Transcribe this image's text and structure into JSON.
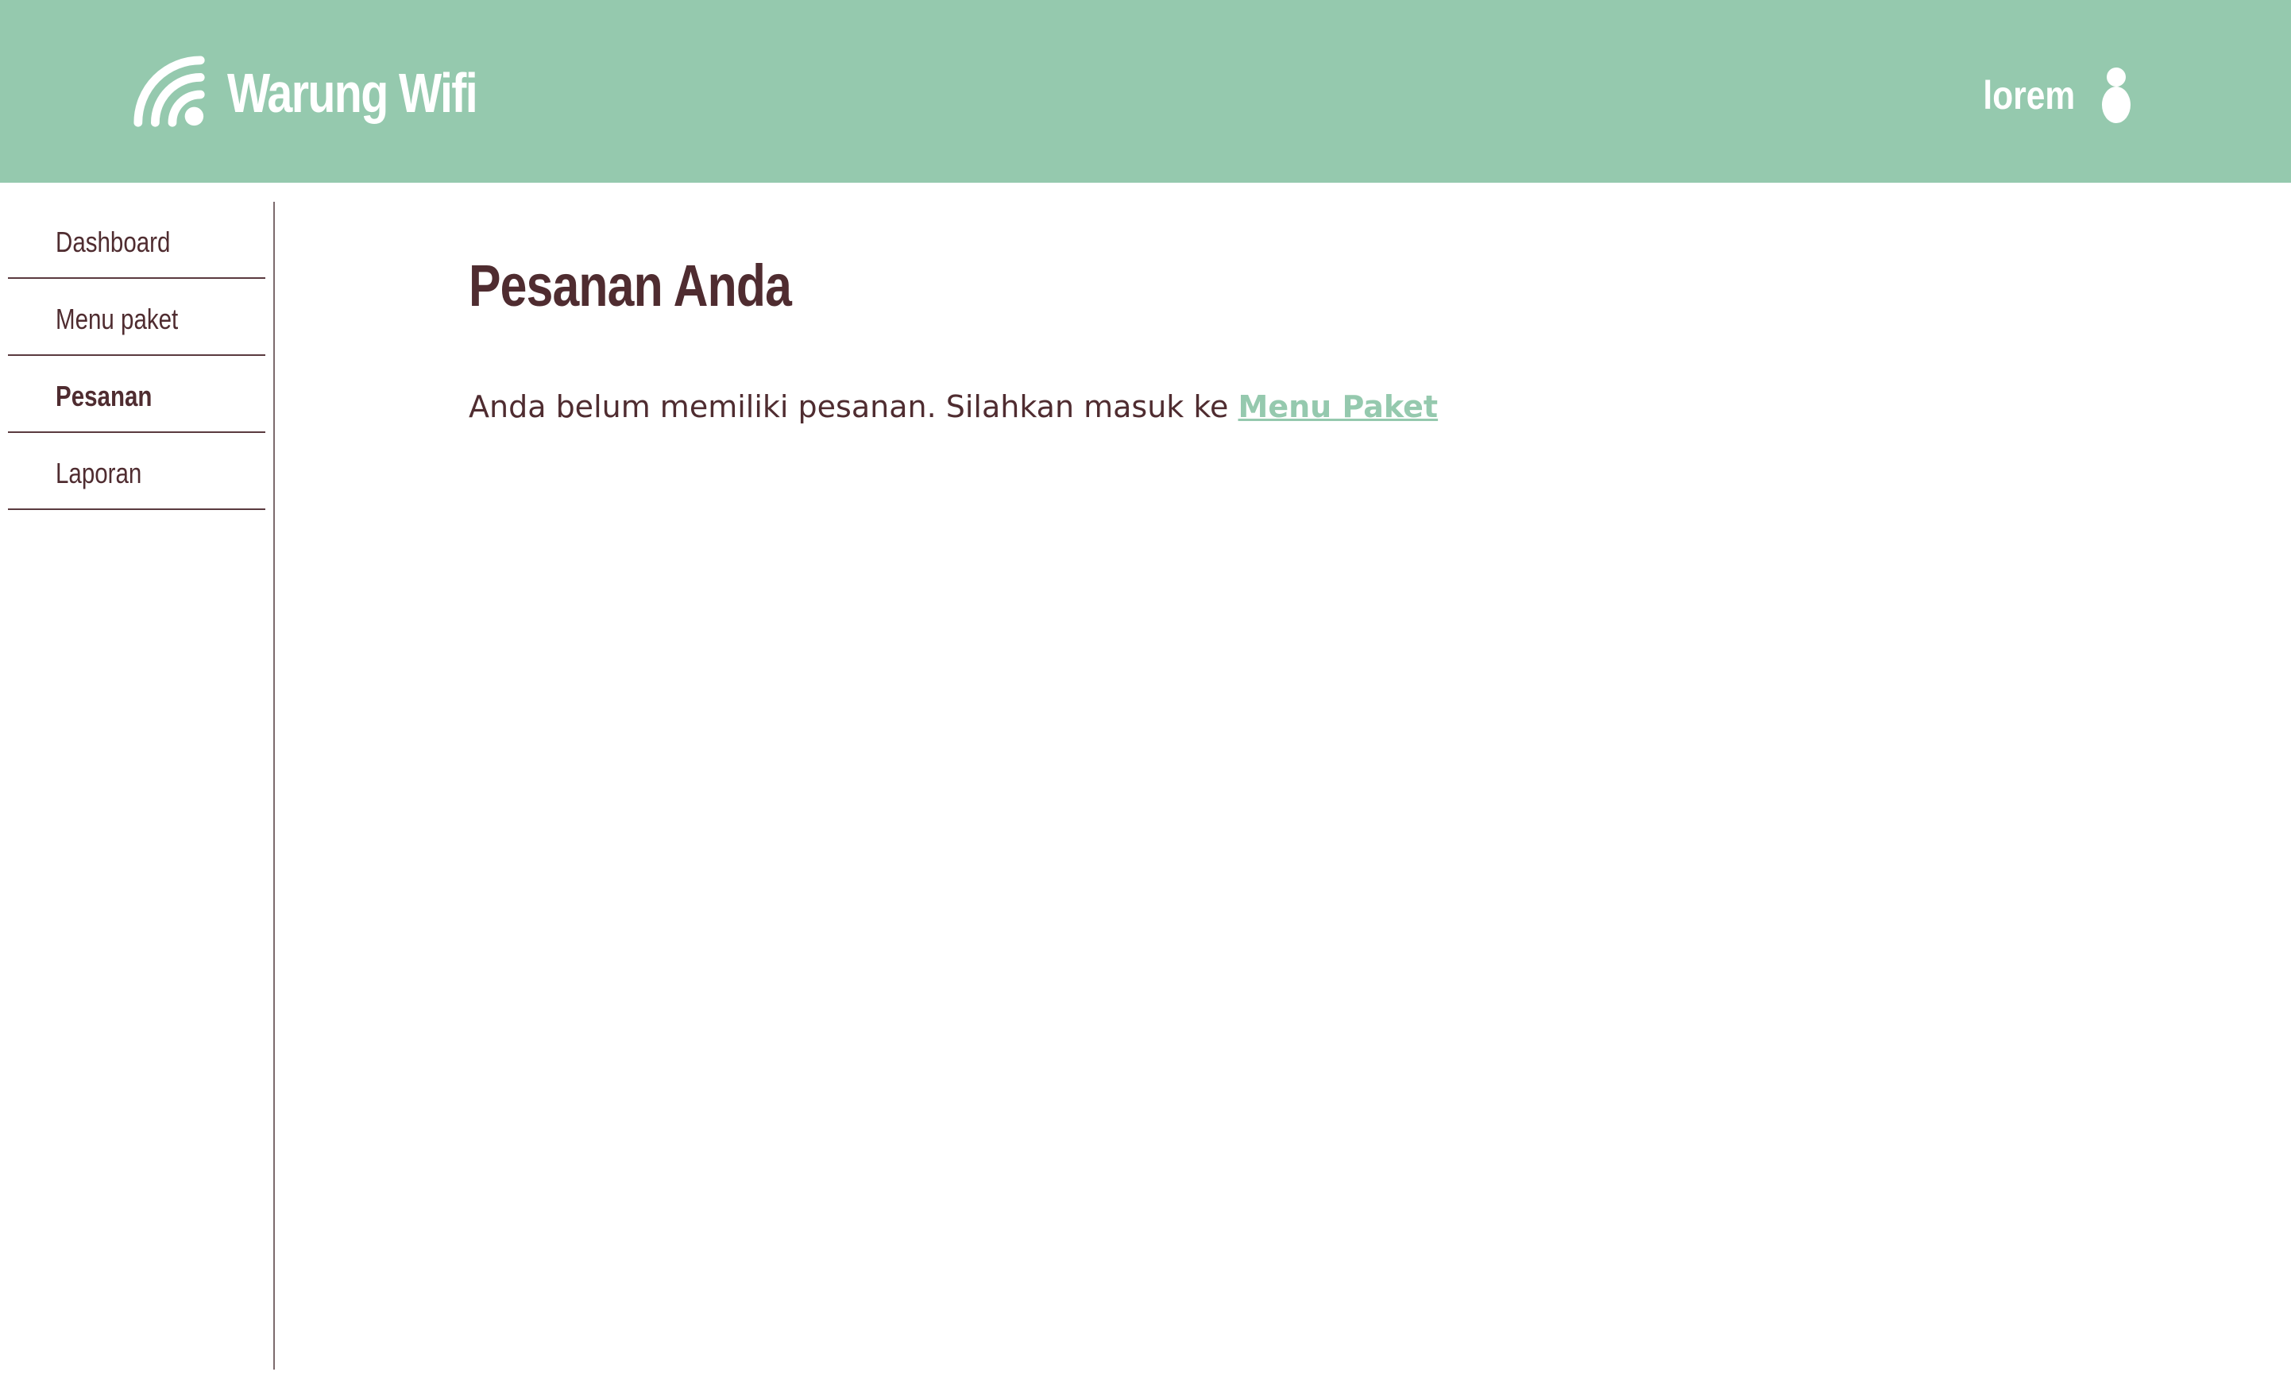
{
  "header": {
    "brand_title": "Warung Wifi",
    "brand_icon": "wifi-icon",
    "user_name": "lorem",
    "user_icon": "user-icon",
    "background_color": "#95c9ae"
  },
  "sidebar": {
    "items": [
      {
        "label": "Dashboard",
        "active": false
      },
      {
        "label": "Menu paket",
        "active": false
      },
      {
        "label": "Pesanan",
        "active": true
      },
      {
        "label": "Laporan",
        "active": false
      }
    ]
  },
  "main": {
    "title": "Pesanan Anda",
    "message": "Anda belum memiliki pesanan. Silahkan masuk ke",
    "link_label": "Menu Paket"
  },
  "colors": {
    "accent": "#95c9ae",
    "text": "#4f2c30",
    "divider": "#5a3a3f"
  }
}
